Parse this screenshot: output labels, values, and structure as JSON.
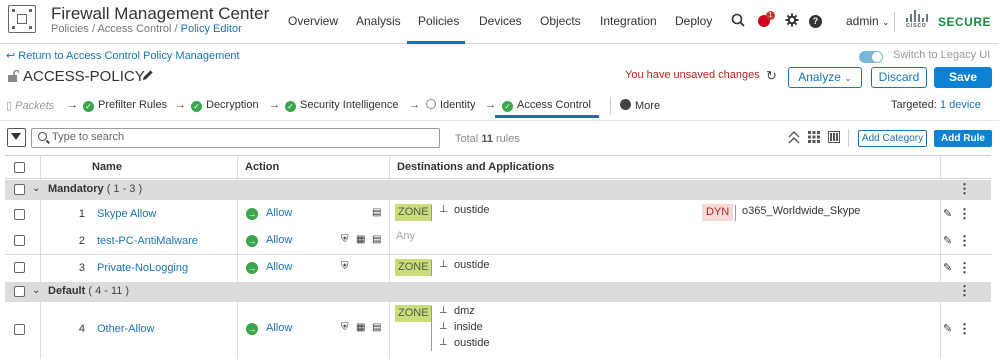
{
  "topnav": {
    "app_title": "Firewall Management Center",
    "breadcrumb_1": "Policies",
    "breadcrumb_sep_1": " / ",
    "breadcrumb_2": "Access Control",
    "breadcrumb_sep_2": " / ",
    "breadcrumb_3": "Policy Editor",
    "tabs": [
      {
        "label": "Overview"
      },
      {
        "label": "Analysis"
      },
      {
        "label": "Policies",
        "active": true
      },
      {
        "label": "Devices"
      },
      {
        "label": "Objects"
      },
      {
        "label": "Integration"
      },
      {
        "label": "Deploy"
      }
    ],
    "alert_count": "1",
    "help_glyph": "?",
    "user": "admin",
    "brand_small": "cisco",
    "brand": "SECURE"
  },
  "header": {
    "return_link": "Return to Access Control Policy Management",
    "legacy_toggle_label": "Switch to Legacy UI",
    "policy_name": "ACCESS-POLICY",
    "unsaved_text": "You have unsaved changes",
    "analyze_label": "Analyze",
    "discard_label": "Discard",
    "save_label": "Save"
  },
  "steps": [
    {
      "label": "Packets",
      "state": "muted"
    },
    {
      "label": "Prefilter Rules",
      "state": "done"
    },
    {
      "label": "Decryption",
      "state": "done"
    },
    {
      "label": "Security Intelligence",
      "state": "done"
    },
    {
      "label": "Identity",
      "state": "empty"
    },
    {
      "label": "Access Control",
      "state": "done",
      "active": true
    },
    {
      "label": "More",
      "state": "more"
    }
  ],
  "targeted": {
    "prefix": "Targeted:",
    "value": "1 device"
  },
  "filter": {
    "search_placeholder": "Type to search",
    "total_prefix": "Total",
    "total_count": "11",
    "total_suffix": "rules",
    "add_category_label": "Add Category",
    "add_rule_label": "Add Rule"
  },
  "table": {
    "columns": {
      "name": "Name",
      "action": "Action",
      "destinations": "Destinations and Applications"
    },
    "sections": [
      {
        "label": "Mandatory",
        "range": "( 1 - 3 )"
      },
      {
        "label": "Default",
        "range": "( 4 - 11 )"
      }
    ],
    "rules": [
      {
        "num": "1",
        "name": "Skype Allow",
        "action": "Allow",
        "zone": "ZONE",
        "networks": [
          "oustide"
        ],
        "dyn": "DYN",
        "app": "o365_Worldwide_Skype"
      },
      {
        "num": "2",
        "name": "test-PC-AntiMalware",
        "action": "Allow",
        "any": "Any"
      },
      {
        "num": "3",
        "name": "Private-NoLogging",
        "action": "Allow",
        "zone": "ZONE",
        "networks": [
          "oustide"
        ]
      },
      {
        "num": "4",
        "name": "Other-Allow",
        "action": "Allow",
        "zone": "ZONE",
        "networks": [
          "dmz",
          "inside",
          "oustide"
        ]
      }
    ]
  },
  "colors": {
    "brand_blue": "#0b82d4",
    "link_blue": "#1a73b8",
    "allow_green": "#3aa54a",
    "zone_green": "#c9dd79",
    "dyn_red": "#f8d9d5",
    "unsaved_red": "#b3261e",
    "secure_green": "#1e8a3c"
  },
  "icons": {
    "app": "fmc-app-icon",
    "search": "search-icon",
    "alerts": "alert-icon",
    "settings": "gear-icon",
    "help": "help-icon",
    "lock": "lock-icon",
    "edit": "pencil-icon",
    "refresh": "refresh-icon",
    "filter": "filter-icon"
  }
}
